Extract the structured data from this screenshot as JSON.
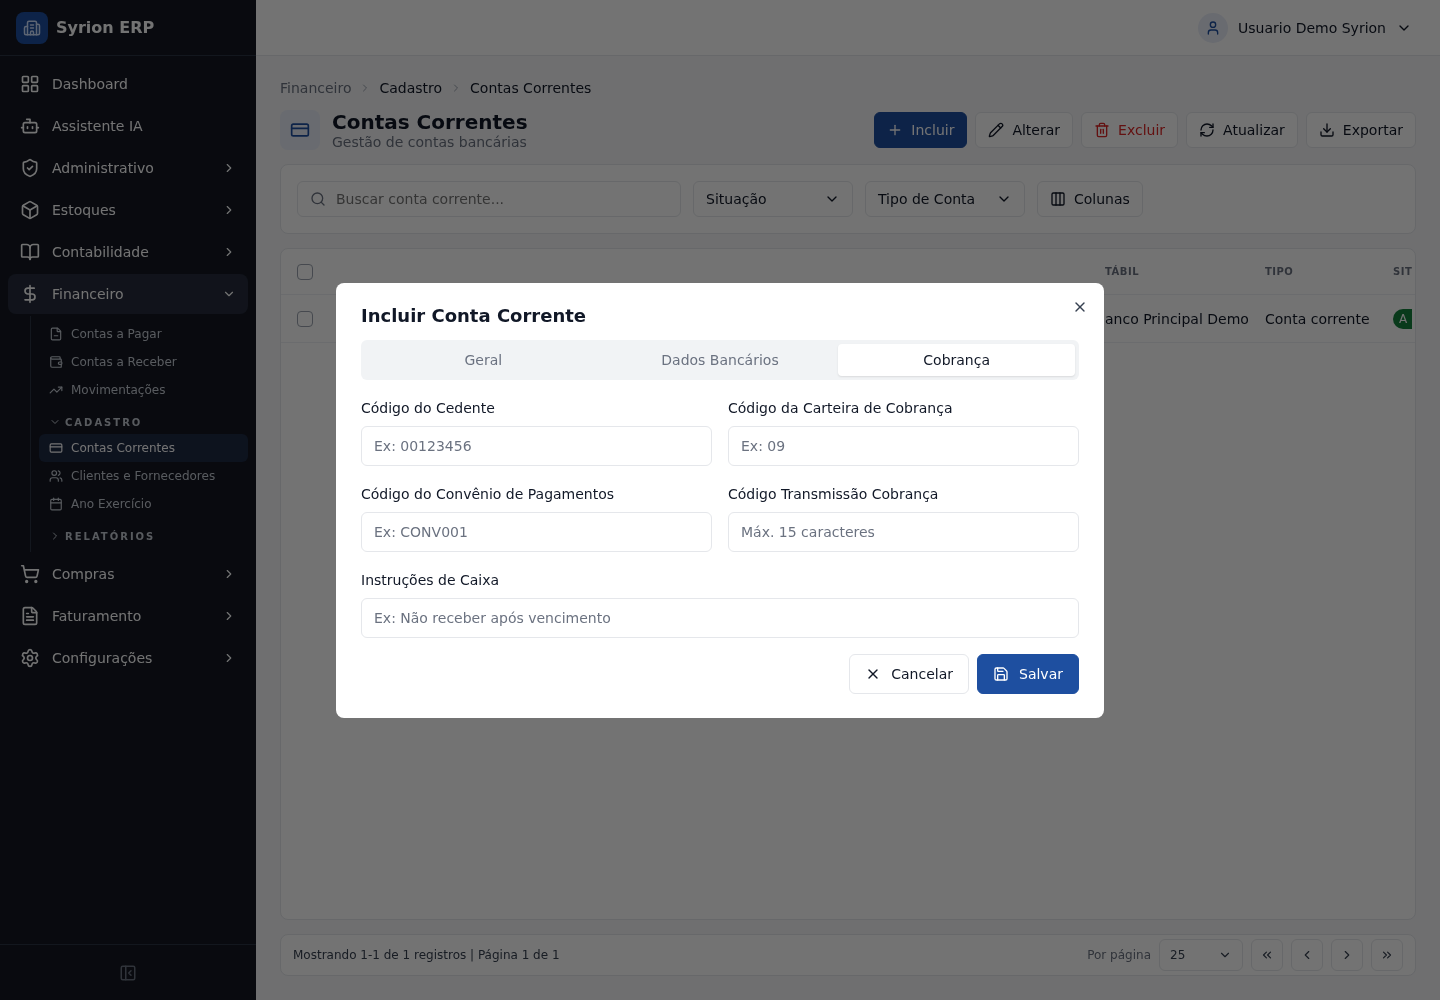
{
  "app": {
    "name": "Syrion ERP"
  },
  "sidebar": {
    "items": [
      {
        "kind": "link",
        "label": "Dashboard"
      },
      {
        "kind": "link",
        "label": "Assistente IA"
      },
      {
        "kind": "group",
        "label": "Administrativo",
        "expanded": false
      },
      {
        "kind": "group",
        "label": "Estoques",
        "expanded": false
      },
      {
        "kind": "group",
        "label": "Contabilidade",
        "expanded": false
      },
      {
        "kind": "group",
        "label": "Financeiro",
        "expanded": true,
        "children": [
          {
            "kind": "link",
            "label": "Contas a Pagar",
            "selected": false
          },
          {
            "kind": "link",
            "label": "Contas a Receber",
            "selected": false
          },
          {
            "kind": "link",
            "label": "Movimentações",
            "selected": false
          },
          {
            "kind": "section",
            "label": "CADASTRO",
            "expanded": true,
            "children": [
              {
                "label": "Contas Correntes",
                "selected": true
              },
              {
                "label": "Clientes e Fornecedores",
                "selected": false
              },
              {
                "label": "Ano Exercício",
                "selected": false
              }
            ]
          },
          {
            "kind": "section",
            "label": "RELATÓRIOS",
            "expanded": false
          }
        ]
      },
      {
        "kind": "group",
        "label": "Compras",
        "expanded": false
      },
      {
        "kind": "group",
        "label": "Faturamento",
        "expanded": false
      },
      {
        "kind": "group",
        "label": "Configurações",
        "expanded": false
      }
    ]
  },
  "user": {
    "name": "Usuario Demo Syrion"
  },
  "breadcrumb": [
    "Financeiro",
    "Cadastro",
    "Contas Correntes"
  ],
  "page": {
    "title": "Contas Correntes",
    "subtitle": "Gestão de contas bancárias"
  },
  "toolbar": [
    {
      "kind": "primary",
      "label": "Incluir"
    },
    {
      "kind": "default",
      "label": "Alterar"
    },
    {
      "kind": "danger",
      "label": "Excluir"
    },
    {
      "kind": "default",
      "label": "Atualizar"
    },
    {
      "kind": "default",
      "label": "Exportar"
    }
  ],
  "filters": {
    "search": {
      "placeholder": "Buscar conta corrente..."
    },
    "selects": [
      "Situação",
      "Tipo de Conta"
    ],
    "columns_button": "Colunas"
  },
  "table": {
    "all_selected": false,
    "columns": [
      "TÁBIL",
      "TIPO",
      "SIT"
    ],
    "rows": [
      {
        "selected": false,
        "cells": [
          "anco Principal Demo",
          "Conta corrente"
        ],
        "status": "A"
      }
    ]
  },
  "pagination": {
    "summary": "Mostrando 1-1 de 1 registros | Página 1 de 1",
    "per_page_label": "Por página",
    "per_page": "25"
  },
  "dialog": {
    "title": "Incluir Conta Corrente",
    "tabs": [
      {
        "label": "Geral",
        "selected": false
      },
      {
        "label": "Dados Bancários",
        "selected": false
      },
      {
        "label": "Cobrança",
        "selected": true
      }
    ],
    "fields": [
      {
        "kind": "half",
        "label": "Código do Cedente",
        "placeholder": "Ex: 00123456"
      },
      {
        "kind": "half",
        "label": "Código da Carteira de Cobrança",
        "placeholder": "Ex: 09"
      },
      {
        "kind": "half",
        "label": "Código do Convênio de Pagamentos",
        "placeholder": "Ex: CONV001"
      },
      {
        "kind": "half",
        "label": "Código Transmissão Cobrança",
        "placeholder": "Máx. 15 caracteres"
      },
      {
        "kind": "wide",
        "label": "Instruções de Caixa",
        "placeholder": "Ex: Não receber após vencimento"
      }
    ],
    "buttons": [
      {
        "kind": "cancel",
        "label": "Cancelar"
      },
      {
        "kind": "save",
        "label": "Salvar"
      }
    ]
  }
}
